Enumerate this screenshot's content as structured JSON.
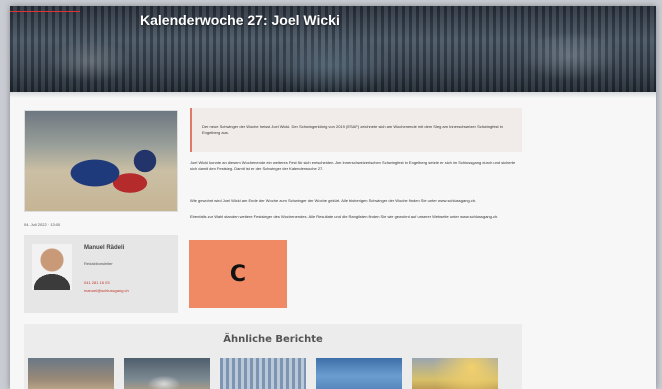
{
  "header": {
    "title": "Kalenderwoche 27: Joel Wicki"
  },
  "article": {
    "image_caption": "04. Juli 2022 · 13:00",
    "intro": "Der neue Schwinger der Woche heisst Joel Wicki. Der Schwingerkönig von 2019 (ESAF) zeichnete sich am Wochenende mit dem Sieg am Innerschweizer Schwingfest in Engelberg aus.",
    "paragraphs": [
      "Joel Wicki konnte an diesem Wochenende ein weiteres Fest für sich entscheiden. Am Innerschweizerischen Schwingfest in Engelberg setzte er sich im Schlussgang durch und sicherte sich damit den Festsieg. Damit ist er der Schwinger der Kalenderwoche 27.",
      "Wie gewohnt wird Joel Wicki am Ende der Woche zum Schwinger der Woche gekürt. Alle bisherigen Schwinger der Woche finden Sie unter www.schlussgang.ch.",
      "Ebenfalls zur Wahl standen weitere Festsieger des Wochenendes. Alle Resultate und die Ranglisten finden Sie wie gewohnt auf unserer Webseite unter www.schlussgang.ch."
    ]
  },
  "author": {
    "name": "Manuel Rädeli",
    "role": "Redaktionsleiter",
    "phone": "041 281 16 03",
    "email": "manuel@schlussgang.ch"
  },
  "badge": {
    "label": "C",
    "color": "#f08a65"
  },
  "similar": {
    "title": "Ähnliche Berichte"
  }
}
